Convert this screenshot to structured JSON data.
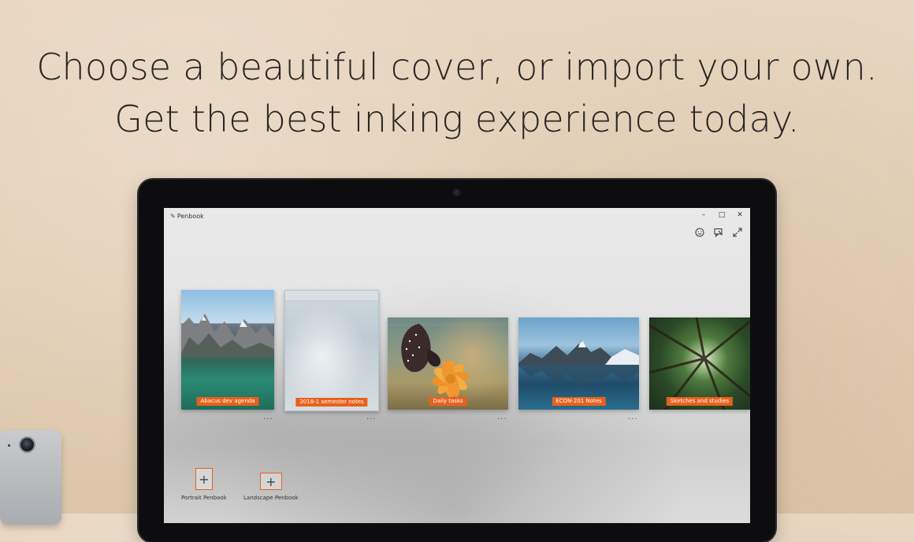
{
  "headline": {
    "line1": "Choose a beautiful cover, or import your own.",
    "line2": "Get the best inking experience today."
  },
  "app": {
    "title": "Penbook",
    "window_controls": [
      "–",
      "□",
      "✕"
    ]
  },
  "toolbar": {
    "icons": [
      "smiley-icon",
      "feedback-icon",
      "fullscreen-icon"
    ]
  },
  "covers": [
    {
      "label": "Abacus dev agenda"
    },
    {
      "label": "2018-1 semester notes"
    },
    {
      "label": "Daily tasks"
    },
    {
      "label": "ECON-201 Notes"
    },
    {
      "label": "Sketches and studies"
    }
  ],
  "more_label": "...",
  "new_penbook": {
    "portrait_label": "Portrait Penbook",
    "landscape_label": "Landscape Penbook",
    "plus": "+"
  },
  "colors": {
    "accent": "#e8611c"
  }
}
